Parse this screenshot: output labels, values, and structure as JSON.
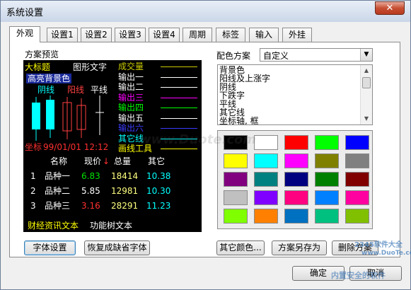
{
  "window": {
    "title": "系统设置",
    "close": "✕"
  },
  "tabs": [
    "外观",
    "设置1",
    "设置2",
    "设置3",
    "设置4",
    "周期",
    "标签",
    "输入",
    "外挂"
  ],
  "left": {
    "section_label": "方案预览"
  },
  "preview": {
    "big_title": "大标题",
    "graph_text": "图形文字",
    "highlight": "高亮背景色",
    "yang": "阳线",
    "yin": "阴线",
    "ping": "平线",
    "outputs": [
      {
        "label": "成交量",
        "color": "#cccc00"
      },
      {
        "label": "输出一",
        "color": "#ffffff"
      },
      {
        "label": "输出二",
        "color": "#ffffff"
      },
      {
        "label": "输出三",
        "color": "#ff00ff"
      },
      {
        "label": "输出四",
        "color": "#00ff00"
      },
      {
        "label": "输出五",
        "color": "#ffffff"
      },
      {
        "label": "输出六",
        "color": "#3b3bff"
      },
      {
        "label": "其它线",
        "color": "#00ffff"
      },
      {
        "label": "画线工具",
        "color": "#ffff00"
      }
    ],
    "coord": "坐标",
    "datetime": "99/01/01 12:12",
    "headers": [
      "名称",
      "现价",
      "总量",
      "其它"
    ],
    "arrow": "↓",
    "rows": [
      {
        "idx": "1",
        "name": "品种一",
        "price": "6.83",
        "volume": "18414",
        "other": "10.38",
        "price_color": "#00e000"
      },
      {
        "idx": "2",
        "name": "品种二",
        "price": "5.85",
        "volume": "12981",
        "other": "10.30",
        "price_color": "#ffffff"
      },
      {
        "idx": "3",
        "name": "品种三",
        "price": "3.16",
        "volume": "28291",
        "other": "11.23",
        "price_color": "#ff3030"
      }
    ],
    "finance_text": "财经资讯文本",
    "function_text": "功能树文本"
  },
  "right": {
    "scheme_label": "配色方案",
    "scheme_value": "自定义",
    "items": [
      "背景色",
      "阳线及上涨字",
      "阴线",
      "下跌字",
      "平线",
      "其它线",
      "坐标轴, 框"
    ]
  },
  "swatch_colors": [
    [
      "#000000",
      "#ffffff",
      "#ff0000",
      "#00ff00",
      "#0000ff"
    ],
    [
      "#ffff00",
      "#00ffff",
      "#ff00ff",
      "#808000",
      "#808080"
    ],
    [
      "#800080",
      "#008080",
      "#000080",
      "#008000",
      "#800000"
    ],
    [
      "#c0c0c0",
      "#8000ff",
      "#ff0080",
      "#0080ff",
      "#ff00a0"
    ],
    [
      "#80ff00",
      "#ff8000",
      "#0070c0",
      "#00c080",
      "#80c000"
    ]
  ],
  "buttons": {
    "font": "字体设置",
    "restore_font": "恢复成缺省字体",
    "other_color": "其它颜色...",
    "save_scheme": "方案另存为",
    "delete_scheme": "删除方案",
    "ok": "确定",
    "cancel": "取消"
  },
  "watermarks": {
    "center": "www.Duote.com",
    "site_cn": "2345软件大全",
    "site": "www.DuoTe.com",
    "security": "内置安全的软件"
  }
}
